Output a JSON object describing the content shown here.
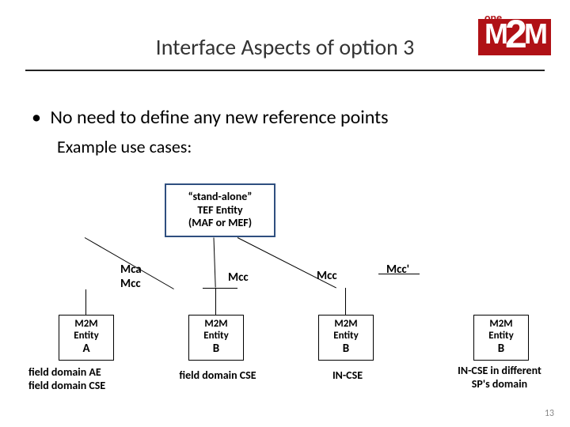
{
  "logo": {
    "sub": "one",
    "m1": "M",
    "two": "2",
    "m2": "M"
  },
  "title": "Interface Aspects of option 3",
  "bullet": "No need to define any new reference points",
  "sub_bullet": "Example use cases:",
  "tef": {
    "l1": "“stand-alone”",
    "l2": "TEF Entity",
    "l3": "(MAF or MEF)"
  },
  "labels": {
    "mca": "Mca",
    "mcc_left": "Mcc",
    "mcc_mid1": "Mcc",
    "mcc_mid2": "Mcc",
    "mcc_prime": "Mcc'"
  },
  "entities": {
    "a": {
      "l1": "M2M",
      "l2": "Entity",
      "sfx": "A"
    },
    "b1": {
      "l1": "M2M",
      "l2": "Entity",
      "sfx": "B"
    },
    "b2": {
      "l1": "M2M",
      "l2": "Entity",
      "sfx": "B"
    },
    "b3": {
      "l1": "M2M",
      "l2": "Entity",
      "sfx": "B"
    }
  },
  "captions": {
    "a1": "field domain AE",
    "a2": "field domain CSE",
    "b1": "field domain CSE",
    "b2": "IN-CSE",
    "b3a": "IN-CSE in different",
    "b3b": "SP's domain"
  },
  "page": "13"
}
